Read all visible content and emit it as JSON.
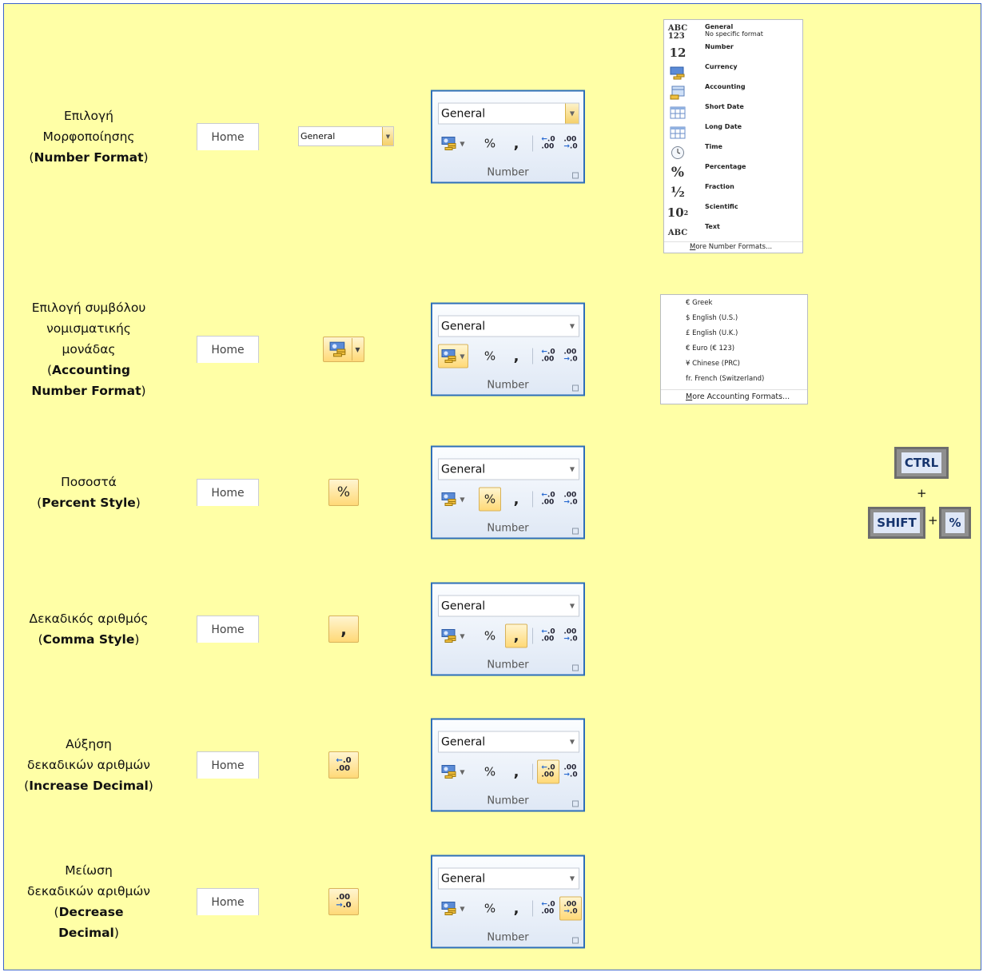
{
  "home_tab_label": "Home",
  "group_label": "Number",
  "format_value": "General",
  "rows": [
    {
      "line1": "Επιλογή",
      "line2": "Μορφοποίησης",
      "en": "Number Format"
    },
    {
      "line1": "Επιλογή συμβόλου",
      "line2": "νομισματικής",
      "line3": "μονάδας",
      "en1": "Accounting",
      "en2": "Number Format"
    },
    {
      "line1": "Ποσοστά",
      "en": "Percent Style"
    },
    {
      "line1": "Δεκαδικός αριθμός",
      "en": "Comma Style"
    },
    {
      "line1": "Αύξηση",
      "line2": "δεκαδικών αριθμών",
      "en": "Increase Decimal"
    },
    {
      "line1": "Μείωση",
      "line2": "δεκαδικών αριθμών",
      "en1": "Decrease",
      "en2": "Decimal"
    }
  ],
  "number_format_menu": {
    "items": [
      {
        "icon": "ABC123",
        "label": "General",
        "sub": "No specific format"
      },
      {
        "icon": "12",
        "label": "Number"
      },
      {
        "icon": "currency-icon",
        "label": "Currency"
      },
      {
        "icon": "accounting-icon",
        "label": "Accounting"
      },
      {
        "icon": "calendar-icon",
        "label": "Short Date"
      },
      {
        "icon": "calendar-icon",
        "label": "Long Date"
      },
      {
        "icon": "clock-icon",
        "label": "Time"
      },
      {
        "icon": "%",
        "label": "Percentage"
      },
      {
        "icon": "½",
        "label": "Fraction"
      },
      {
        "icon": "10²",
        "label": "Scientific"
      },
      {
        "icon": "ABC",
        "label": "Text"
      }
    ],
    "more_prefix": "M",
    "more_rest": "ore Number Formats..."
  },
  "accounting_menu": {
    "items": [
      "€ Greek",
      "$ English (U.S.)",
      "£ English (U.K.)",
      "€ Euro (€ 123)",
      "¥ Chinese (PRC)",
      "fr. French (Switzerland)"
    ],
    "more_prefix": "M",
    "more_rest": "ore Accounting Formats..."
  },
  "shortcut": {
    "ctrl": "CTRL",
    "shift": "SHIFT",
    "pct": "%",
    "plus": "+"
  },
  "colors": {
    "background": "#ffffa6",
    "border": "#3a62c9",
    "ribbon_border": "#2e6fb8",
    "highlight": "#ffd977"
  }
}
